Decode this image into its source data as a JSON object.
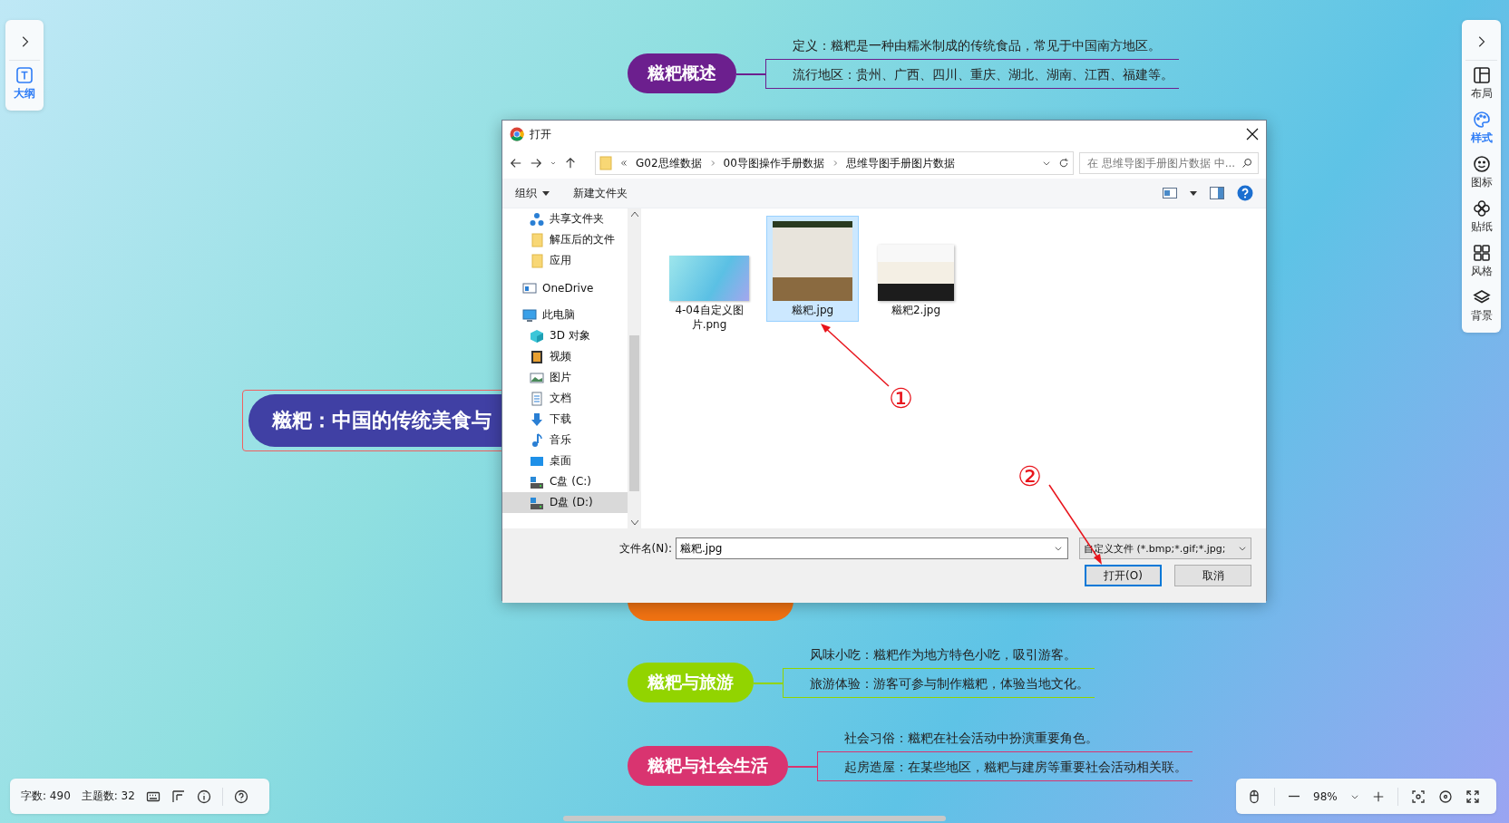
{
  "left_panel": {
    "items": [
      {
        "label": "大纲",
        "selected": true
      }
    ]
  },
  "right_panel": {
    "items": [
      {
        "label": "布局",
        "kind": "layout",
        "selected": false
      },
      {
        "label": "样式",
        "kind": "style",
        "selected": true
      },
      {
        "label": "图标",
        "kind": "emoji",
        "selected": false
      },
      {
        "label": "贴纸",
        "kind": "sticker",
        "selected": false
      },
      {
        "label": "风格",
        "kind": "theme",
        "selected": false
      },
      {
        "label": "背景",
        "kind": "background",
        "selected": false
      }
    ]
  },
  "mind_map": {
    "central": {
      "text": "糍粑：中国的传统美食与",
      "selected": true
    },
    "branches": [
      {
        "text": "糍粑概述",
        "color": "#6c1f8e",
        "leaves": [
          "定义：糍粑是一种由糯米制成的传统食品，常见于中国南方地区。",
          "流行地区：贵州、广西、四川、重庆、湖北、湖南、江西、福建等。"
        ]
      },
      {
        "color": "#f07212"
      },
      {
        "text": "糍粑与旅游",
        "color": "#92d400",
        "leaves": [
          "风味小吃：糍粑作为地方特色小吃，吸引游客。",
          "旅游体验：游客可参与制作糍粑，体验当地文化。"
        ]
      },
      {
        "text": "糍粑与社会生活",
        "color": "#d93470",
        "leaves": [
          "社会习俗：糍粑在社会活动中扮演重要角色。",
          "起房造屋：在某些地区，糍粑与建房等重要社会活动相关联。"
        ]
      }
    ]
  },
  "dialog": {
    "title": "打开",
    "path": [
      "G02思维数据",
      "00导图操作手册数据",
      "思维导图手册图片数据"
    ],
    "search_placeholder": "在 思维导图手册图片数据 中...",
    "toolbar": [
      "组织",
      "新建文件夹"
    ],
    "nav": [
      {
        "children": [
          {
            "label": "共享文件夹",
            "kind": "share",
            "selected": false
          },
          {
            "label": "解压后的文件",
            "kind": "folder",
            "selected": false
          },
          {
            "label": "应用",
            "kind": "folder",
            "selected": false
          }
        ]
      },
      {
        "label": "OneDrive",
        "kind": "cloud",
        "selected": false
      },
      {
        "label": "此电脑",
        "kind": "pc",
        "selected": false,
        "children": [
          {
            "label": "3D 对象",
            "kind": "cube",
            "selected": false
          },
          {
            "label": "视频",
            "kind": "video",
            "selected": false
          },
          {
            "label": "图片",
            "kind": "pictures",
            "selected": false
          },
          {
            "label": "文档",
            "kind": "docs",
            "selected": false
          },
          {
            "label": "下载",
            "kind": "download",
            "selected": false
          },
          {
            "label": "音乐",
            "kind": "music",
            "selected": false
          },
          {
            "label": "桌面",
            "kind": "desktop",
            "selected": false
          },
          {
            "label": "C盘 (C:)",
            "kind": "drive",
            "selected": false
          },
          {
            "label": "D盘 (D:)",
            "kind": "drive",
            "selected": true
          }
        ]
      }
    ],
    "files": [
      {
        "name": "4-04自定义图片.png",
        "kind": "gradient",
        "selected": false
      },
      {
        "name": "糍粑.jpg",
        "kind": "photo",
        "selected": true
      },
      {
        "name": "糍粑2.jpg",
        "kind": "photo_wide",
        "selected": false
      }
    ],
    "filename_label": "文件名(N):",
    "filename": "糍粑.jpg",
    "filetype": "自定义文件 (*.bmp;*.gif;*.jpg;",
    "buttons": [
      "打开(O)",
      "取消"
    ]
  },
  "annotations": [
    {
      "label": "①"
    },
    {
      "label": "②"
    }
  ],
  "status_bar": {
    "word_count": "字数: 490",
    "topic_count": "主题数: 32",
    "zoom": "98%"
  }
}
